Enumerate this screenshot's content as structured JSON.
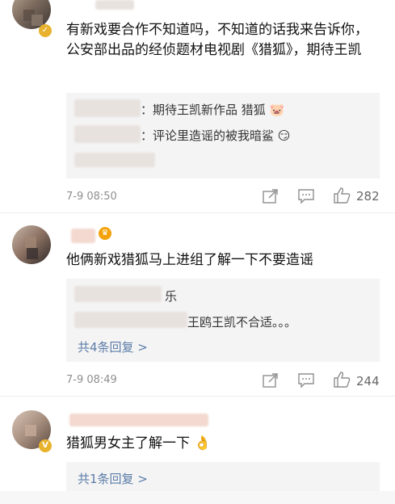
{
  "comments": [
    {
      "text": "有新戏要合作不知道吗，不知道的话我来告诉你，公安部出品的经侦题材电视剧《猎狐》，期待王凯",
      "replies": [
        {
          "text": "：期待王凯新作品 猎狐",
          "emoji": "🐷"
        },
        {
          "text": "：评论里造谣的被我暗鲨",
          "emoji": "😏"
        }
      ],
      "time": "7-9 08:50",
      "likes": "282"
    },
    {
      "text": "他俩新戏猎狐马上进组了解一下不要造谣",
      "replies": [
        {
          "text": "乐"
        },
        {
          "text": "王鸥王凯不合适。。。"
        }
      ],
      "more": "共4条回复 >",
      "time": "7-9 08:49",
      "likes": "244"
    },
    {
      "text": "猎狐男女主了解一下",
      "emoji": "👌",
      "more": "共1条回复 >"
    }
  ],
  "icons": [
    "share-icon",
    "comment-icon",
    "like-icon",
    "vip-crown-icon",
    "verified-badge-icon"
  ],
  "colors": {
    "link": "#5b7ca8",
    "reply_bg": "#f4f4f4",
    "meta": "#8f8f8f",
    "verified": "#e8b22d",
    "vip": "#f4a20c"
  }
}
